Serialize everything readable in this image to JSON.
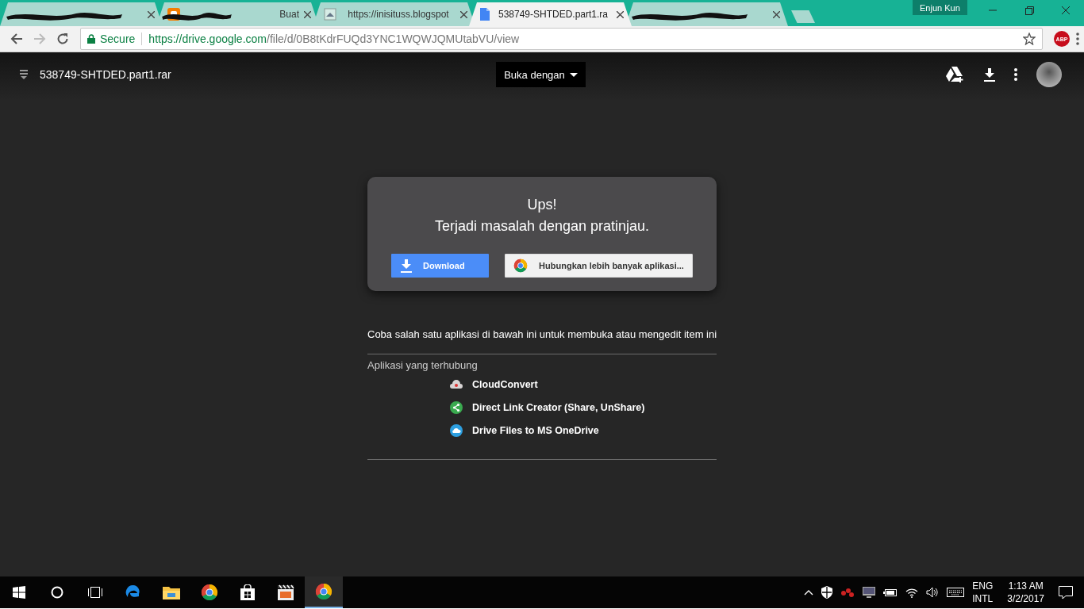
{
  "browser": {
    "tabs": [
      {
        "kind": "redacted",
        "selected": false
      },
      {
        "kind": "blogger",
        "title": "Buat",
        "selected": false
      },
      {
        "kind": "page",
        "title": "https://inisituss.blogspot",
        "selected": false
      },
      {
        "kind": "doc",
        "title": "538749-SHTDED.part1.ra",
        "selected": true
      },
      {
        "kind": "redacted",
        "selected": false
      }
    ],
    "profile": "Enjun Kun",
    "secure_label": "Secure",
    "url_host": "https://drive.google.com",
    "url_path": "/file/d/0B8tKdrFUQd3YNC1WQWJQMUtabVU/view",
    "extension_badge": "ABP"
  },
  "drive": {
    "file_name": "538749-SHTDED.part1.rar",
    "open_with": "Buka dengan",
    "error": {
      "title": "Ups!",
      "message": "Terjadi masalah dengan pratinjau.",
      "download": "Download",
      "connect": "Hubungkan lebih banyak aplikasi..."
    },
    "hint": "Coba salah satu aplikasi di bawah ini untuk membuka atau mengedit item ini",
    "section": "Aplikasi yang terhubung",
    "apps": [
      {
        "name": "CloudConvert",
        "kind": "cloud-convert",
        "color": "#d8d4d4"
      },
      {
        "name": "Direct Link Creator (Share, UnShare)",
        "kind": "share",
        "color": "#3aaa4f"
      },
      {
        "name": "Drive Files to MS OneDrive",
        "kind": "cloud",
        "color": "#2d9fe0"
      }
    ]
  },
  "taskbar": {
    "apps": [
      {
        "kind": "edge",
        "selected": false
      },
      {
        "kind": "explorer",
        "selected": false
      },
      {
        "kind": "chrome",
        "selected": false
      },
      {
        "kind": "store",
        "selected": false
      },
      {
        "kind": "media",
        "selected": false
      },
      {
        "kind": "chrome",
        "selected": true
      }
    ],
    "language": "ENG",
    "layout": "INTL",
    "time": "1:13 AM",
    "date": "3/2/2017"
  }
}
